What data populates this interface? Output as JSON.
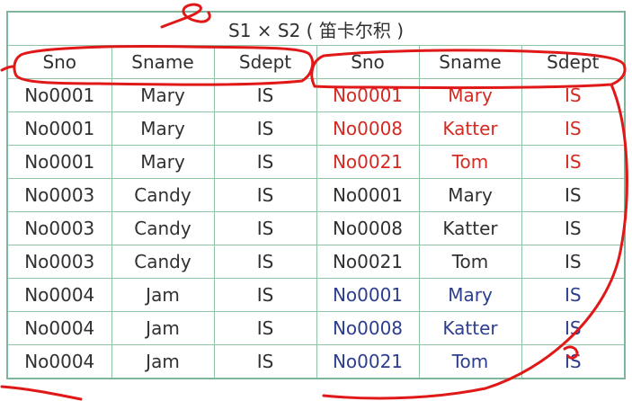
{
  "table": {
    "caption": "S1 × S2 ( 笛卡尔积 )",
    "headers": [
      "Sno",
      "Sname",
      "Sdept",
      "Sno",
      "Sname",
      "Sdept"
    ],
    "rows": [
      [
        "No0001",
        "Mary",
        "IS",
        "No0001",
        "Mary",
        "IS"
      ],
      [
        "No0001",
        "Mary",
        "IS",
        "No0008",
        "Katter",
        "IS"
      ],
      [
        "No0001",
        "Mary",
        "IS",
        "No0021",
        "Tom",
        "IS"
      ],
      [
        "No0003",
        "Candy",
        "IS",
        "No0001",
        "Mary",
        "IS"
      ],
      [
        "No0003",
        "Candy",
        "IS",
        "No0008",
        "Katter",
        "IS"
      ],
      [
        "No0003",
        "Candy",
        "IS",
        "No0021",
        "Tom",
        "IS"
      ],
      [
        "No0004",
        "Jam",
        "IS",
        "No0001",
        "Mary",
        "IS"
      ],
      [
        "No0004",
        "Jam",
        "IS",
        "No0008",
        "Katter",
        "IS"
      ],
      [
        "No0004",
        "Jam",
        "IS",
        "No0021",
        "Tom",
        "IS"
      ]
    ]
  },
  "colors": {
    "border": "#8fc3a8",
    "text": "#303030",
    "highlight_red": "#d42a22",
    "highlight_blue": "#2c3e8c",
    "annotation_red": "#e01818"
  }
}
